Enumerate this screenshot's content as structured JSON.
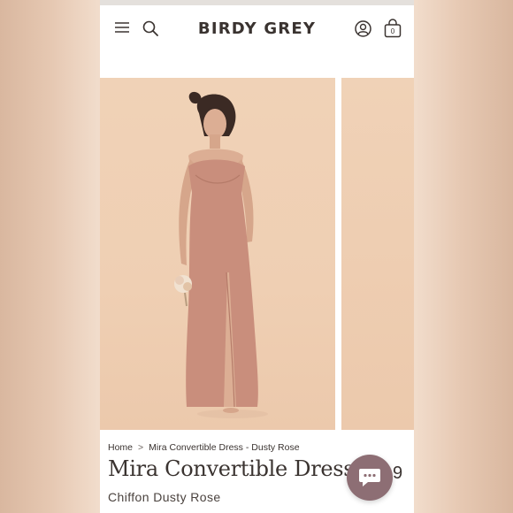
{
  "header": {
    "brand": "BIRDY GREY",
    "icons": [
      "menu-icon",
      "search-icon",
      "account-icon",
      "bag-icon"
    ],
    "bag_count": "0"
  },
  "gallery": {
    "images": [
      "product-photo-front",
      "product-photo-next"
    ]
  },
  "breadcrumb": {
    "home": "Home",
    "separator": ">",
    "current": "Mira Convertible Dress - Dusty Rose"
  },
  "product": {
    "name": "Mira Convertible Dress",
    "variant": "Chiffon Dusty Rose",
    "price_fragment": "9"
  },
  "chat": {
    "icon": "chat-icon"
  },
  "colors": {
    "dress": "#c98e7c",
    "photo_bg": "#f0d2b7",
    "text": "#3a3330",
    "chat_button": "#8d6e74"
  }
}
